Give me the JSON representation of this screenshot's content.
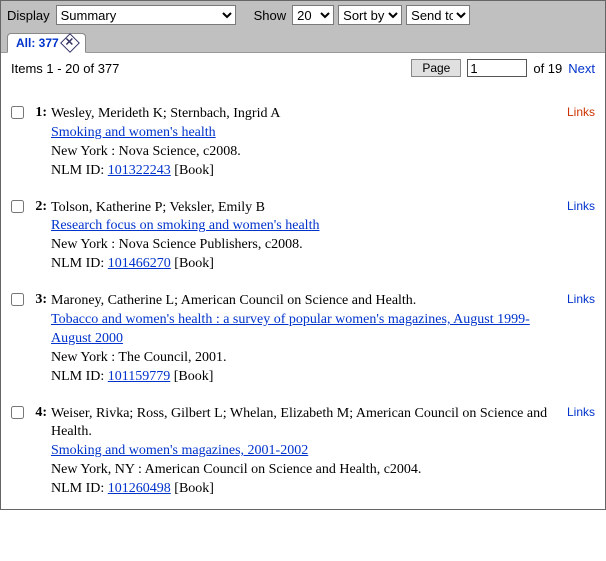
{
  "toolbar": {
    "display_label": "Display",
    "display_value": "Summary",
    "show_label": "Show",
    "show_value": "20",
    "sortby_value": "Sort by",
    "sendto_value": "Send to"
  },
  "tab": {
    "label": "All: 377"
  },
  "pager": {
    "items_text": "Items 1 - 20 of 377",
    "page_btn": "Page",
    "page_value": "1",
    "of_text": "of 19",
    "next": "Next"
  },
  "results": [
    {
      "num": "1:",
      "authors": "Wesley, Merideth K; Sternbach, Ingrid A",
      "title": "Smoking and women's health",
      "publisher": "New York : Nova Science, c2008.",
      "nlm_label": "NLM ID: ",
      "nlm_id": "101322243",
      "format": " [Book]",
      "links_label": "Links",
      "links_color": "red"
    },
    {
      "num": "2:",
      "authors": "Tolson, Katherine P; Veksler, Emily B",
      "title": "Research focus on smoking and women's health",
      "publisher": "New York : Nova Science Publishers, c2008.",
      "nlm_label": "NLM ID: ",
      "nlm_id": "101466270",
      "format": " [Book]",
      "links_label": "Links",
      "links_color": "blue"
    },
    {
      "num": "3:",
      "authors": "Maroney, Catherine L; American Council on Science and Health.",
      "title": "Tobacco and women's health : a survey of popular women's magazines, August 1999-August 2000",
      "publisher": "New York : The Council, 2001.",
      "nlm_label": "NLM ID: ",
      "nlm_id": "101159779",
      "format": " [Book]",
      "links_label": "Links",
      "links_color": "blue"
    },
    {
      "num": "4:",
      "authors": "Weiser, Rivka; Ross, Gilbert L; Whelan, Elizabeth M; American Council on Science and Health.",
      "title": "Smoking and women's magazines, 2001-2002",
      "publisher": "New York, NY : American Council on Science and Health, c2004.",
      "nlm_label": "NLM ID: ",
      "nlm_id": "101260498",
      "format": " [Book]",
      "links_label": "Links",
      "links_color": "blue"
    }
  ]
}
